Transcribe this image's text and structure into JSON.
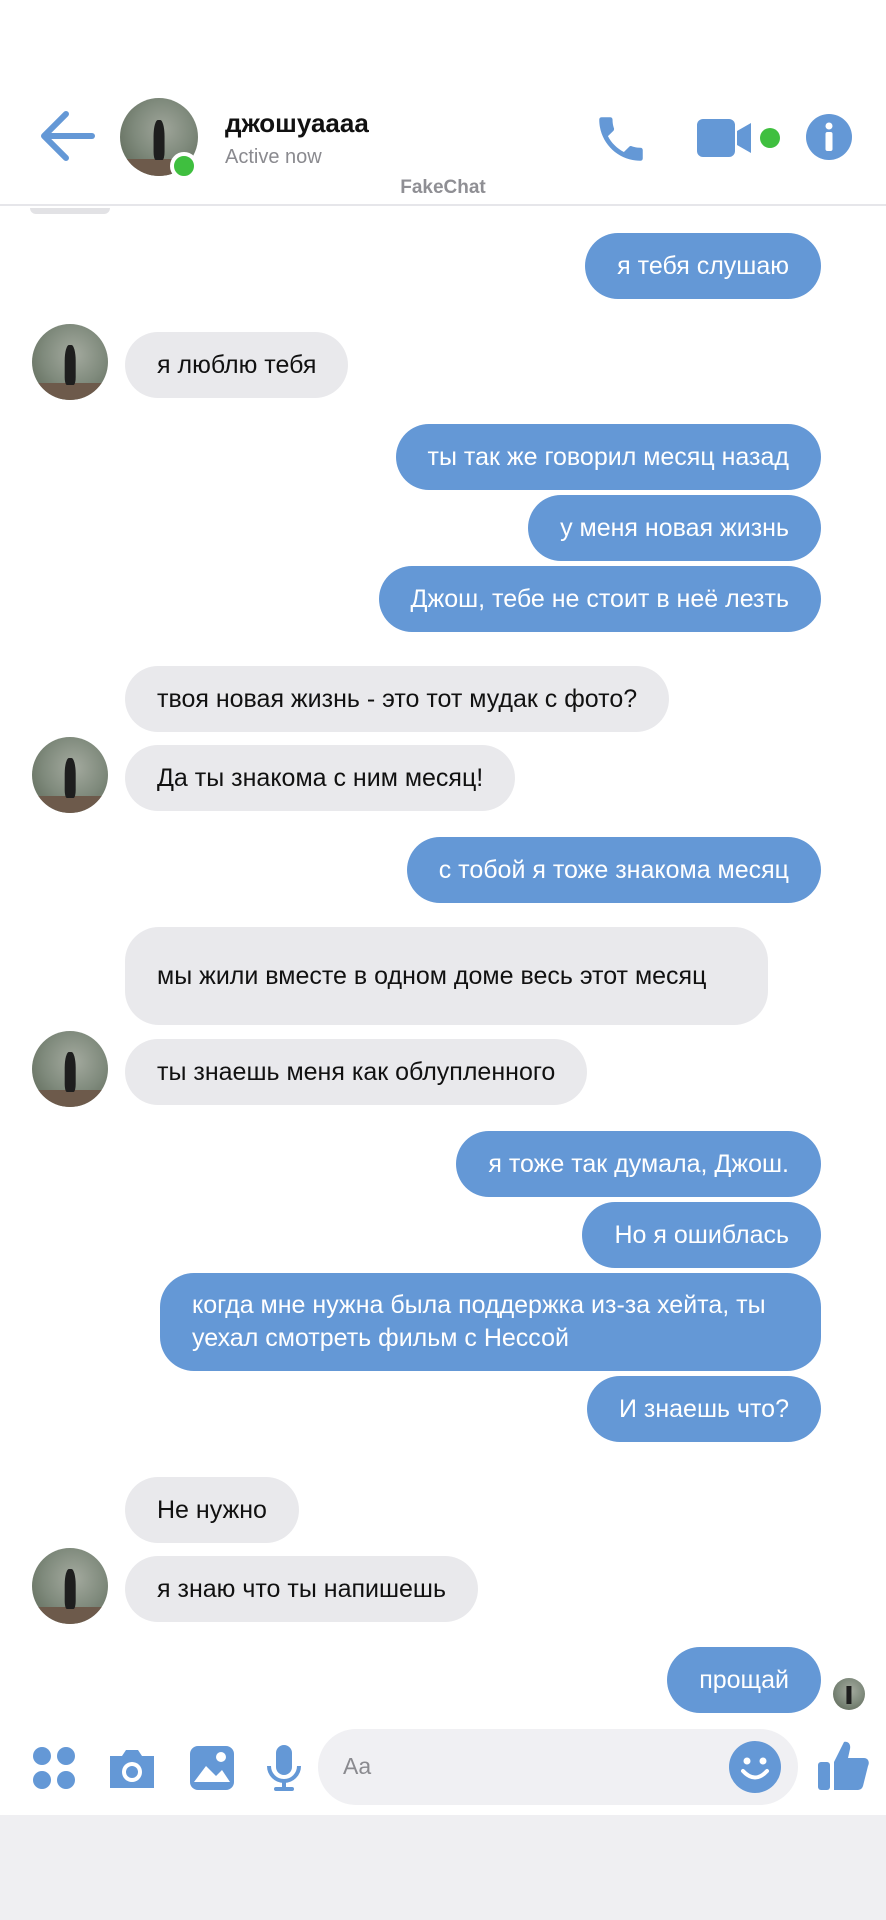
{
  "header": {
    "contact_name": "джошуаааа",
    "status": "Active now",
    "watermark": "FakeChat"
  },
  "colors": {
    "accent": "#6498d6",
    "incoming_bubble": "#e9e9ec",
    "online": "#3fbf3f"
  },
  "icons": [
    "back-arrow-icon",
    "phone-icon",
    "video-camera-icon",
    "info-icon",
    "apps-icon",
    "camera-icon",
    "gallery-icon",
    "microphone-icon",
    "emoji-icon",
    "thumbs-up-icon"
  ],
  "messages": [
    {
      "dir": "out",
      "text": "я тебя слушаю"
    },
    {
      "dir": "in",
      "text": "я люблю тебя"
    },
    {
      "dir": "out",
      "text": "ты так же говорил месяц назад"
    },
    {
      "dir": "out",
      "text": "у меня новая жизнь"
    },
    {
      "dir": "out",
      "text": "Джош, тебе не стоит в неё лезть"
    },
    {
      "dir": "in",
      "text": "твоя новая жизнь - это тот мудак с фото?"
    },
    {
      "dir": "in",
      "text": "Да ты знакома с ним месяц!"
    },
    {
      "dir": "out",
      "text": "с тобой я тоже знакома месяц"
    },
    {
      "dir": "in",
      "text": "мы жили вместе в одном доме весь этот месяц"
    },
    {
      "dir": "in",
      "text": "ты знаешь меня как облупленного"
    },
    {
      "dir": "out",
      "text": "я тоже так думала, Джош."
    },
    {
      "dir": "out",
      "text": "Но я ошиблась"
    },
    {
      "dir": "out",
      "text": "когда мне нужна была поддержка из-за хейта, ты уехал смотреть фильм с Нессой"
    },
    {
      "dir": "out",
      "text": "И знаешь что?"
    },
    {
      "dir": "in",
      "text": "Не нужно"
    },
    {
      "dir": "in",
      "text": "я знаю что ты напишешь"
    },
    {
      "dir": "out",
      "text": "прощай"
    }
  ],
  "composer": {
    "placeholder": "Aa"
  }
}
